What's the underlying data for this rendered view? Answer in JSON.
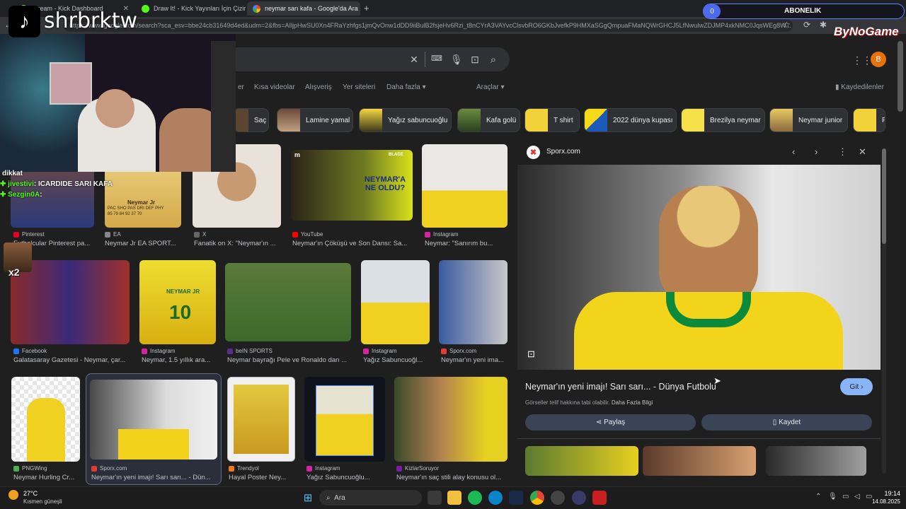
{
  "browser": {
    "tabs": [
      {
        "label": "Stream - Kick Dashboard"
      },
      {
        "label": "Draw It! - Kick Yayınları İçin Çizim"
      },
      {
        "label": "neymar sarı kafa - Google'da Ara"
      }
    ],
    "url": "https://www.google.com/search?sca_esv=bbe24cb31649d4ed&udm=2&fbs=AIljpHwSU0Xn4FRaYzhfgs1jmQvOnw1dDD9iiBulB2fsjeHv6Rzi_t8nCYrA3VAYvcClsvbRO6GKbJvefkP9HMXaSGgQmpuaFMaNQWrGHCJ5LfNwuIwZDJMP4xkNMC0JqsWEg8W..."
  },
  "overlay": {
    "tiktok_handle": "shrbrktw",
    "subscribe_count": "0",
    "subscribe_label": "ABONELIK",
    "brand": "ByNoGame",
    "chat": [
      {
        "user": "dikkat",
        "msg": ""
      },
      {
        "user": "jivestivi",
        "msg": ": ICARDIDE SARI KAFA"
      },
      {
        "user": "Sezgin0A",
        "msg": ":"
      }
    ],
    "multiplier": "x2"
  },
  "google": {
    "profile_initial": "B",
    "nav": [
      {
        "label": "er"
      },
      {
        "label": "Kısa videolar"
      },
      {
        "label": "Alışveriş"
      },
      {
        "label": "Yer siteleri"
      },
      {
        "label": "Daha fazla"
      }
    ],
    "tools_label": "Araçlar",
    "saved_label": "Kaydedilenler",
    "chips": [
      {
        "label": "Saç"
      },
      {
        "label": "Lamine yamal"
      },
      {
        "label": "Yağız sabuncuoğlu"
      },
      {
        "label": "Kafa golü"
      },
      {
        "label": "T shirt"
      },
      {
        "label": "2022 dünya kupası"
      },
      {
        "label": "Brezilya neymar"
      },
      {
        "label": "Neymar junior"
      },
      {
        "label": "Fu"
      }
    ],
    "results": [
      {
        "source": "Pinterest",
        "caption": "Futbolcular Pinterest pa...",
        "color": "#e60023"
      },
      {
        "source": "EA",
        "caption": "Neymar Jr EA SPORT...",
        "color": "#888"
      },
      {
        "source": "X",
        "caption": "Fanatik on X: \"Neymar'ın ...",
        "color": "#666"
      },
      {
        "source": "YouTube",
        "caption": "Neymar'ın Çöküşü ve Son Dansı: Sa...",
        "color": "#ff0000"
      },
      {
        "source": "Instagram",
        "caption": "Neymar: \"Sanırım bu...",
        "color": "#d6249f"
      },
      {
        "source": "Facebook",
        "caption": "Galatasaray Gazetesi - Neymar, çar...",
        "color": "#1877f2"
      },
      {
        "source": "Instagram",
        "caption": "Neymar, 1.5 yıllık ara...",
        "color": "#d6249f"
      },
      {
        "source": "beIN SPORTS",
        "caption": "Neymar bayrağı Pele ve Ronaldo dan ...",
        "color": "#5b2d8e"
      },
      {
        "source": "Instagram",
        "caption": "Yağız Sabuncuoğl...",
        "color": "#d6249f"
      },
      {
        "source": "Sporx.com",
        "caption": "Neymar'ın yeni ima...",
        "color": "#e53935"
      },
      {
        "source": "PNGWing",
        "caption": "Neymar Hurling Cr...",
        "color": "#4caf50"
      },
      {
        "source": "Sporx.com",
        "caption": "Neymar'ın yeni imajı! Sarı sarı... - Dün...",
        "color": "#e53935"
      },
      {
        "source": "Trendyol",
        "caption": "Hayal Poster Ney...",
        "color": "#f27a1a"
      },
      {
        "source": "Instagram",
        "caption": "Yağız Sabuncuoğlu...",
        "color": "#d6249f"
      },
      {
        "source": "KizlarSoruyor",
        "caption": "Neymar'ın saç stili alay konusu ol...",
        "color": "#7b1fa2"
      }
    ],
    "thumb_texts": {
      "ea_name": "Neymar Jr",
      "ea_stats": "PAC SHO PAS DRI DEF PHY",
      "ea_vals": "85 79 84 92 37 70",
      "yt_brand": "BLADE",
      "yt_title": "NEYMAR'A NE OLDU?",
      "jersey_name": "NEYMAR JR",
      "jersey_num": "10"
    },
    "panel": {
      "site": "Sporx.com",
      "title": "Neymar'ın yeni imajı! Sarı sarı... - Dünya Futbolu",
      "go_label": "Git",
      "copyright": "Görseller telif hakkına tabi olabilir.",
      "more_info": "Daha Fazla Bilgi",
      "share_label": "Paylaş",
      "save_label": "Kaydet"
    }
  },
  "taskbar": {
    "temp": "27°C",
    "weather": "Kısmen güneşli",
    "search_placeholder": "Ara",
    "time": "19:14",
    "date": "14.08.2025"
  }
}
